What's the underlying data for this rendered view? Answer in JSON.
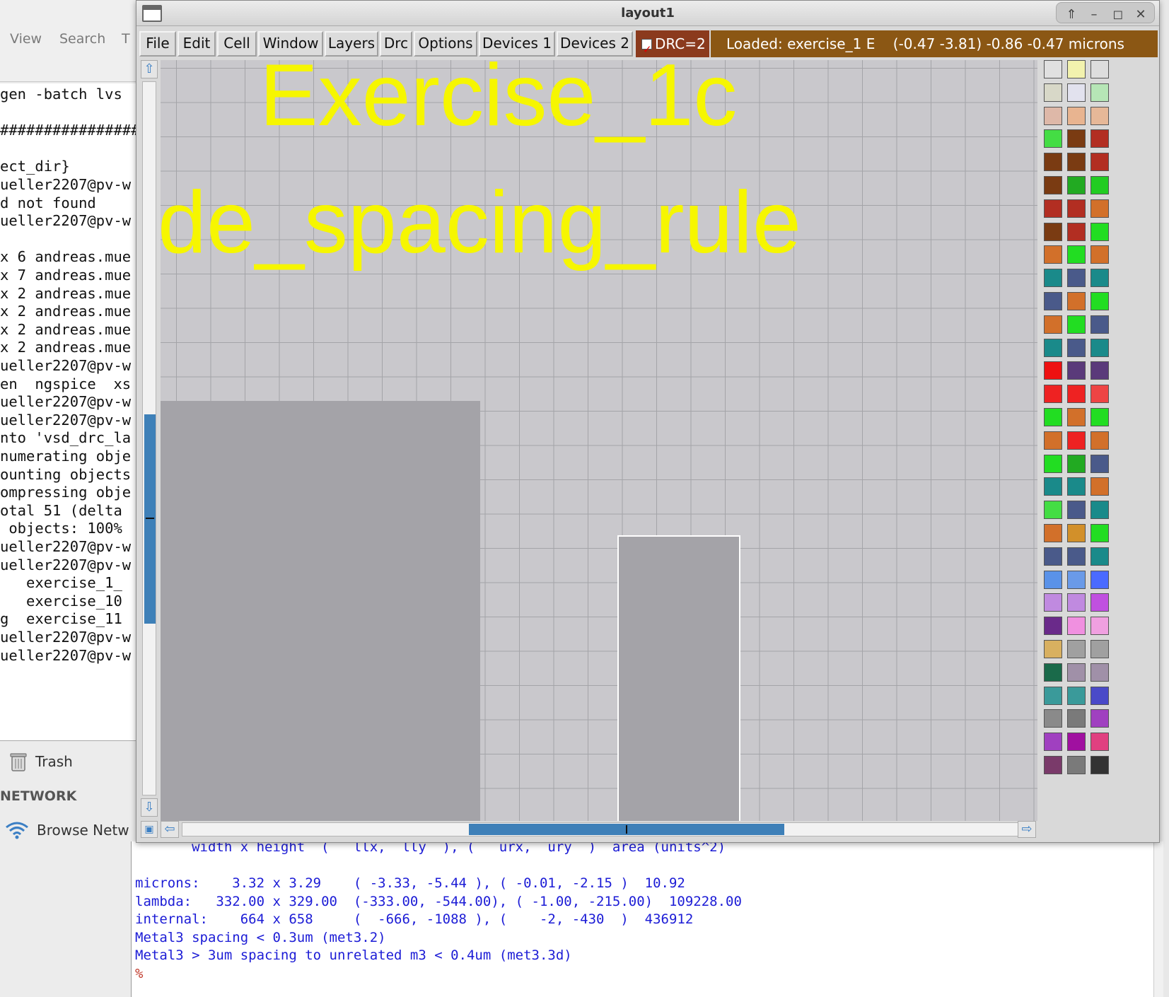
{
  "file_manager": {
    "menu": [
      "View",
      "Search",
      "T"
    ],
    "trash_label": "Trash",
    "network_heading": "NETWORK",
    "browse_network_label": "Browse Netw"
  },
  "background_terminal": {
    "lines": [
      "gen -batch lvs",
      "",
      "################",
      "",
      "ect_dir}",
      "ueller2207@pv-w",
      "d not found",
      "ueller2207@pv-w",
      "",
      "x 6 andreas.mue",
      "x 7 andreas.mue",
      "x 2 andreas.mue",
      "x 2 andreas.mue",
      "x 2 andreas.mue",
      "x 2 andreas.mue",
      "ueller2207@pv-w",
      "en  ngspice  xs",
      "ueller2207@pv-w",
      "ueller2207@pv-w",
      "nto 'vsd_drc_la",
      "numerating obje",
      "ounting objects",
      "ompressing obje",
      "otal 51 (delta",
      " objects: 100%",
      "ueller2207@pv-w",
      "ueller2207@pv-w",
      "   exercise_1_",
      "   exercise_10",
      "g  exercise_11",
      "ueller2207@pv-w",
      "ueller2207@pv-w"
    ]
  },
  "window": {
    "title": "layout1",
    "menu": [
      {
        "label": "File"
      },
      {
        "label": "Edit"
      },
      {
        "label": "Cell"
      },
      {
        "label": "Window"
      },
      {
        "label": "Layers"
      },
      {
        "label": "Drc"
      },
      {
        "label": "Options"
      },
      {
        "label": "Devices 1"
      },
      {
        "label": "Devices 2"
      }
    ],
    "drc_label": "DRC=2",
    "drc_checked": true,
    "status_text": "Loaded: exercise_1 E    (-0.47 -3.81) -0.86 -0.47 microns"
  },
  "canvas": {
    "label_line1": "Exercise_1c",
    "label_line2": "de_spacing_rule",
    "label_color": "#f6f600",
    "metal_color": "#a4a3a8"
  },
  "scroll": {
    "vertical_position": 0.47,
    "horizontal_position": 0.34
  },
  "palette": {
    "swatches": [
      [
        "#e0e0e0",
        "#f2f2ae",
        "#dddddd"
      ],
      [
        "#d8d8c8",
        "#e2e2ee",
        "#b6e6b6"
      ],
      [
        "#deb8a8",
        "#e8b490",
        "#e6b898"
      ],
      [
        "#44dd44",
        "#7a3b12",
        "#b22e22"
      ],
      [
        "#7a3b12",
        "#7a3b12",
        "#b22e22"
      ],
      [
        "#7a3b12",
        "#22aa22",
        "#22cc22"
      ],
      [
        "#b22e22",
        "#b22e22",
        "#d2702a"
      ],
      [
        "#7a3b12",
        "#b22e22",
        "#22dd22"
      ],
      [
        "#d2702a",
        "#22dd22",
        "#d2702a"
      ],
      [
        "#1a8a8a",
        "#4a5a8a",
        "#1a8a8a"
      ],
      [
        "#4a5a8a",
        "#d2702a",
        "#22dd22"
      ],
      [
        "#d2702a",
        "#22dd22",
        "#4a5a8a"
      ],
      [
        "#1a8a8a",
        "#4a5a8a",
        "#1a8a8a"
      ],
      [
        "#ee1111",
        "#5a3a7a",
        "#5a3a7a"
      ],
      [
        "#ee2222",
        "#ee2222",
        "#ee4444"
      ],
      [
        "#22dd22",
        "#d2702a",
        "#22dd22"
      ],
      [
        "#d2702a",
        "#ee2222",
        "#d2702a"
      ],
      [
        "#22dd22",
        "#22aa22",
        "#4a5a8a"
      ],
      [
        "#1a8a8a",
        "#1a8a8a",
        "#d2702a"
      ],
      [
        "#44dd44",
        "#4a5a8a",
        "#1a8a8a"
      ],
      [
        "#d2702a",
        "#d2902a",
        "#22dd22"
      ],
      [
        "#4a5a8a",
        "#4a5a8a",
        "#1a8a8a"
      ],
      [
        "#5a92e8",
        "#6a9ae8",
        "#4a6aff"
      ],
      [
        "#c08ae0",
        "#c08ae0",
        "#c050e0"
      ],
      [
        "#6a2a8a",
        "#f090e0",
        "#f0a0e0"
      ],
      [
        "#d8b060",
        "#a0a0a0",
        "#a0a0a0"
      ],
      [
        "#1a6a4a",
        "#a090a8",
        "#a090a8"
      ],
      [
        "#3a9a9a",
        "#3a9a9a",
        "#4a4ac8"
      ],
      [
        "#8a8a8a",
        "#7a7a7a",
        "#a040c0"
      ],
      [
        "#a040c0",
        "#a010a0",
        "#e04080"
      ],
      [
        "#7a3a6a",
        "#7a7a7a",
        "#333333"
      ]
    ]
  },
  "console": {
    "lines": [
      "       width x height  (   llx,  lly  ), (   urx,  ury  )  area (units^2)",
      "",
      "microns:    3.32 x 3.29    ( -3.33, -5.44 ), ( -0.01, -2.15 )  10.92",
      "lambda:   332.00 x 329.00  (-333.00, -544.00), ( -1.00, -215.00)  109228.00",
      "internal:    664 x 658     (  -666, -1088 ), (    -2, -430  )  436912",
      "Metal3 spacing < 0.3um (met3.2)",
      "Metal3 > 3um spacing to unrelated m3 < 0.4um (met3.3d)"
    ],
    "prompt": "%"
  }
}
